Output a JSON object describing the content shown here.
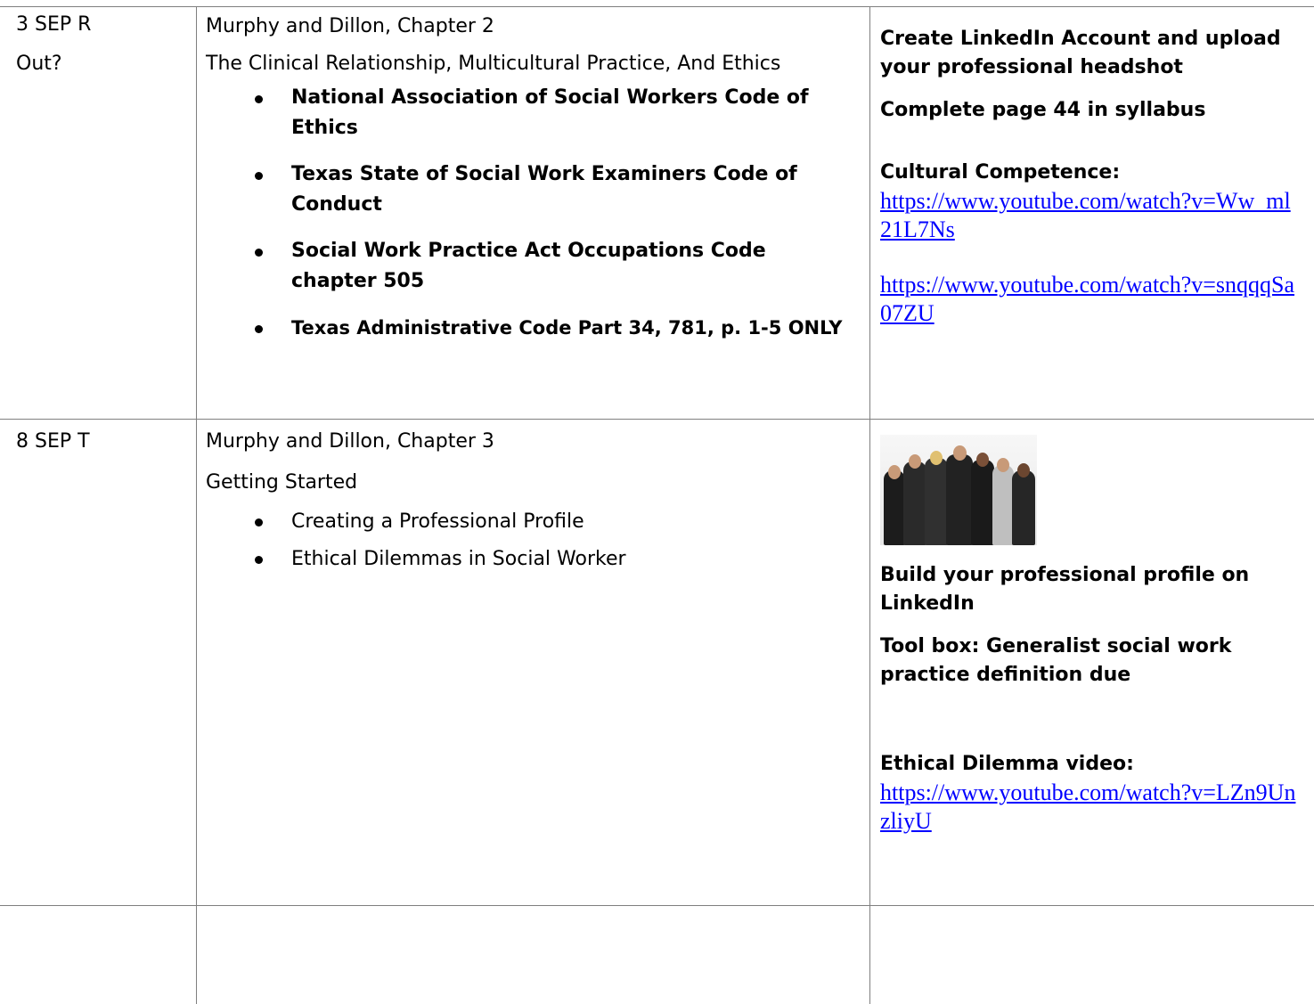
{
  "rows": [
    {
      "date": "3 SEP R",
      "date_note": "Out?",
      "reading": "Murphy and Dillon, Chapter 2",
      "topic": "The Clinical Relationship, Multicultural Practice, And Ethics",
      "bullets": [
        "National Association of Social Workers Code of Ethics",
        "Texas State of Social Work Examiners Code of Conduct",
        "Social Work Practice Act Occupations Code chapter 505",
        "Texas Administrative Code Part 34, 781, p. 1-5 ONLY"
      ],
      "assignment": {
        "task1": "Create LinkedIn Account and upload your professional headshot",
        "task2": "Complete page 44 in syllabus",
        "video_heading": "Cultural Competence:",
        "link1": "https://www.youtube.com/watch?v=Ww_ml21L7Ns",
        "link2": "https://www.youtube.com/watch?v=snqqqSa07ZU"
      }
    },
    {
      "date": "8 SEP T",
      "reading": "Murphy and Dillon, Chapter 3",
      "topic": "Getting Started",
      "bullets": [
        "Creating a Professional Profile",
        "Ethical Dilemmas in Social Worker"
      ],
      "assignment": {
        "image_alt": "business-people-photo",
        "task1": "Build your professional profile on LinkedIn",
        "task2": "Tool box: Generalist social work practice definition due",
        "video_heading": "Ethical Dilemma video:",
        "link1": "https://www.youtube.com/watch?v=LZn9UnzliyU"
      }
    }
  ]
}
